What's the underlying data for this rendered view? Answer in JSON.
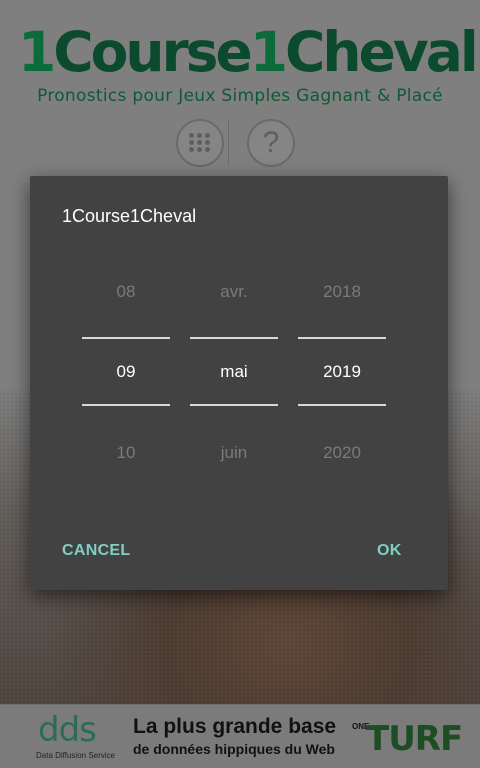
{
  "background": {
    "logo": {
      "part1": "1",
      "part2": "Course",
      "part3": "1",
      "part4": "Cheval"
    },
    "tagline": "Pronostics pour Jeux Simples Gagnant & Placé",
    "buttons": {
      "help_symbol": "?"
    },
    "banner": {
      "dds_logo": "dds",
      "dds_subtitle": "Data Diffusion Service",
      "line1": "La plus grande base",
      "line2": "de données hippiques du Web",
      "oneturf_one": "ONE",
      "oneturf_turf": "TURF"
    }
  },
  "dialog": {
    "title": "1Course1Cheval",
    "day": {
      "prev": "08",
      "current": "09",
      "next": "10"
    },
    "month": {
      "prev": "avr.",
      "current": "mai",
      "next": "juin"
    },
    "year": {
      "prev": "2018",
      "current": "2019",
      "next": "2020"
    },
    "cancel_label": "CANCEL",
    "ok_label": "OK"
  },
  "colors": {
    "dialog_bg": "#424242",
    "accent": "#7fcfc3",
    "logo_green": "#0c4a2e"
  }
}
